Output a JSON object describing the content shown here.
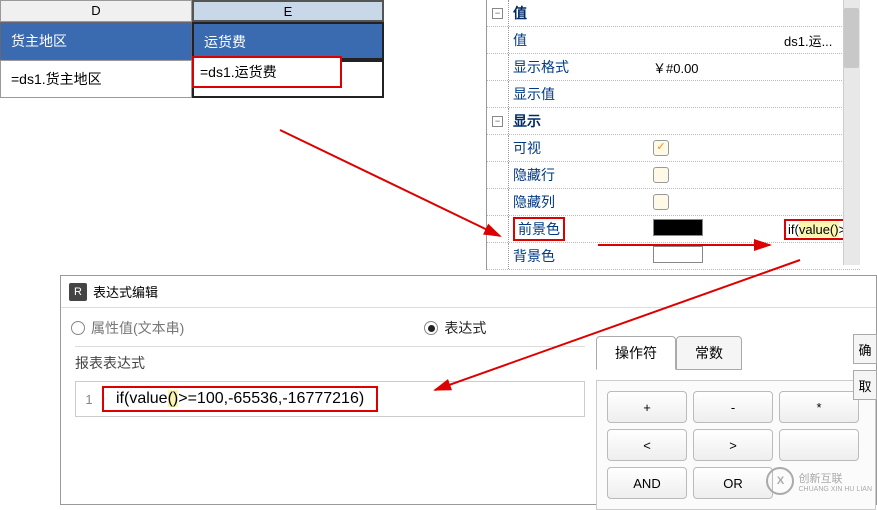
{
  "spreadsheet": {
    "cols": [
      "D",
      "E"
    ],
    "header": {
      "d": "货主地区",
      "e": "运货费"
    },
    "row": {
      "d": "=ds1.货主地区",
      "e": "=ds1.运货费"
    }
  },
  "props": {
    "group1_label": "值",
    "value_label": "值",
    "value_extra": "ds1.运...",
    "format_label": "显示格式",
    "format_value": "￥#0.00",
    "dispval_label": "显示值",
    "group2_label": "显示",
    "visible_label": "可视",
    "hiderow_label": "隐藏行",
    "hidecol_label": "隐藏列",
    "fgcolor_label": "前景色",
    "fgcolor_expr_html": "if(<span class=\"yellow-highlight\">value()</span>>",
    "bgcolor_label": "背景色"
  },
  "dialog": {
    "title": "表达式编辑",
    "radio_literal": "属性值(文本串)",
    "radio_expr": "表达式",
    "expr_section_label": "报表表达式",
    "expr_line": "1",
    "expr_text_html": "if(value<span class=\"paren\">()</span>>=100,-65536,-16777216)",
    "tabs": {
      "operators": "操作符",
      "constants": "常数"
    },
    "buttons": {
      "plus": "+",
      "minus": "-",
      "star": "*",
      "lt": "<",
      "gt": ">",
      "and": "AND",
      "or": "OR"
    },
    "ok": "确",
    "take": "取"
  },
  "watermark": {
    "brand": "创新互联",
    "sub": "CHUANG XIN HU LIAN",
    "icon": "X"
  }
}
